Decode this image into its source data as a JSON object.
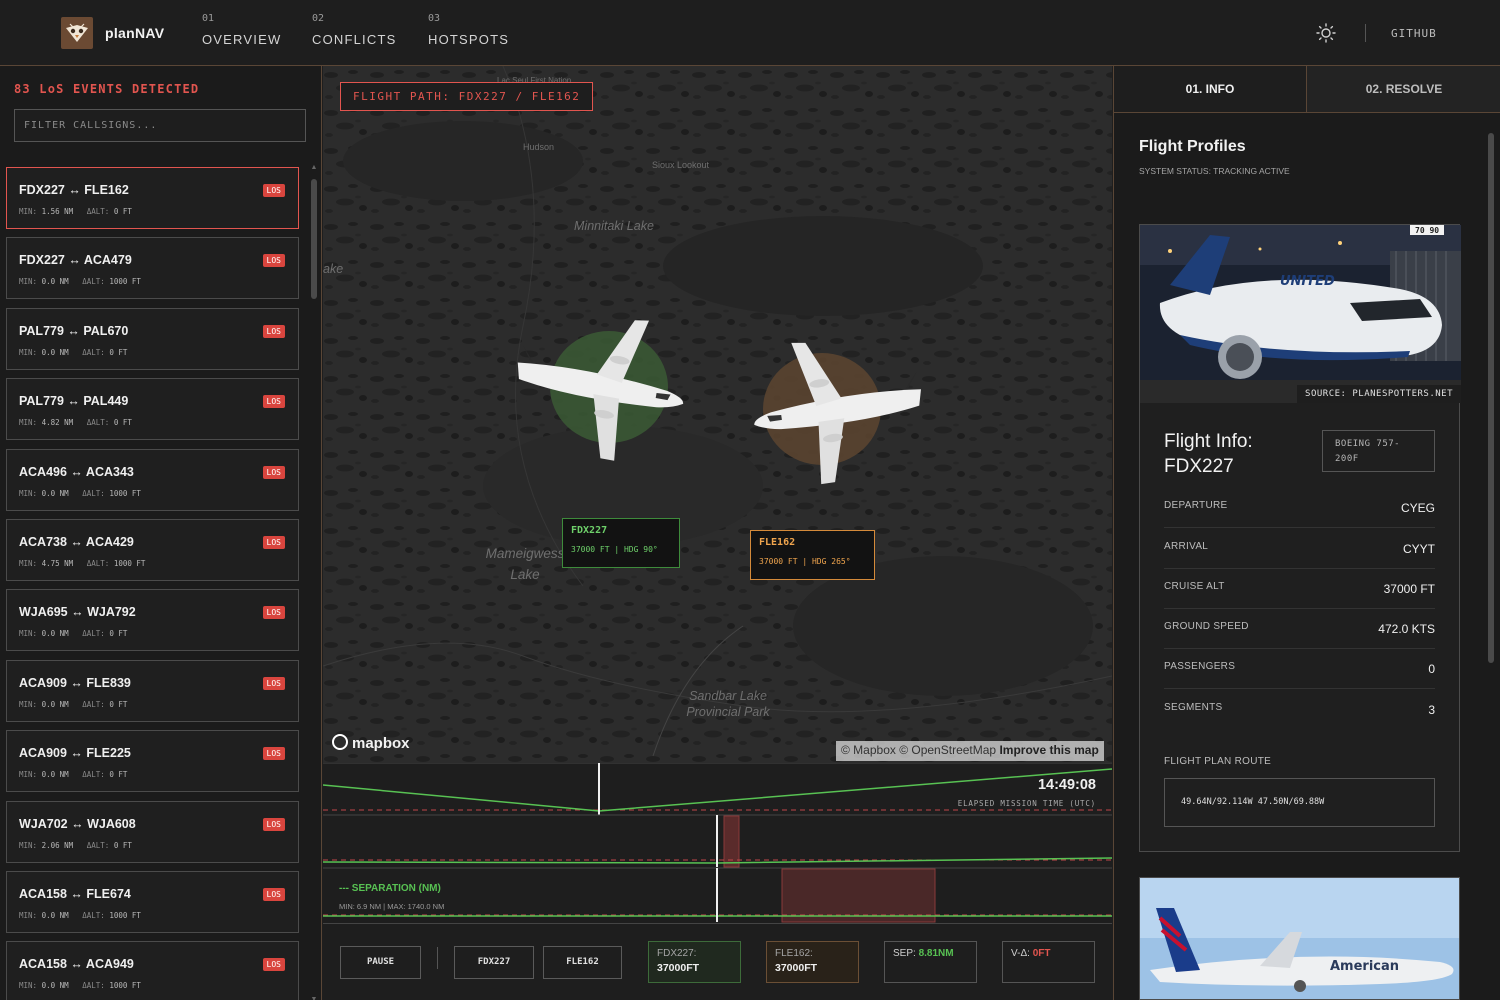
{
  "brand": {
    "name": "planNAV"
  },
  "nav": [
    {
      "num": "01",
      "label": "OVERVIEW"
    },
    {
      "num": "02",
      "label": "CONFLICTS"
    },
    {
      "num": "03",
      "label": "HOTSPOTS"
    }
  ],
  "header": {
    "github": "GITHUB"
  },
  "left": {
    "title": "83 LoS EVENTS DETECTED",
    "filter_placeholder": "FILTER CALLSIGNS...",
    "min_key": "MIN:",
    "alt_key": "ΔALT:",
    "events": [
      {
        "pair": "FDX227 ↔ FLE162",
        "badge": "LOS",
        "min": "1.56 NM",
        "dalt": "0 FT"
      },
      {
        "pair": "FDX227 ↔ ACA479",
        "badge": "LOS",
        "min": "0.0 NM",
        "dalt": "1000 FT"
      },
      {
        "pair": "PAL779 ↔ PAL670",
        "badge": "LOS",
        "min": "0.0 NM",
        "dalt": "0 FT"
      },
      {
        "pair": "PAL779 ↔ PAL449",
        "badge": "LOS",
        "min": "4.82 NM",
        "dalt": "0 FT"
      },
      {
        "pair": "ACA496 ↔ ACA343",
        "badge": "LOS",
        "min": "0.0 NM",
        "dalt": "1000 FT"
      },
      {
        "pair": "ACA738 ↔ ACA429",
        "badge": "LOS",
        "min": "4.75 NM",
        "dalt": "1000 FT"
      },
      {
        "pair": "WJA695 ↔ WJA792",
        "badge": "LOS",
        "min": "0.0 NM",
        "dalt": "0 FT"
      },
      {
        "pair": "ACA909 ↔ FLE839",
        "badge": "LOS",
        "min": "0.0 NM",
        "dalt": "0 FT"
      },
      {
        "pair": "ACA909 ↔ FLE225",
        "badge": "LOS",
        "min": "0.0 NM",
        "dalt": "0 FT"
      },
      {
        "pair": "WJA702 ↔ WJA608",
        "badge": "LOS",
        "min": "2.06 NM",
        "dalt": "0 FT"
      },
      {
        "pair": "ACA158 ↔ FLE674",
        "badge": "LOS",
        "min": "0.0 NM",
        "dalt": "1000 FT"
      },
      {
        "pair": "ACA158 ↔ ACA949",
        "badge": "LOS",
        "min": "0.0 NM",
        "dalt": "1000 FT"
      }
    ]
  },
  "map": {
    "path_label": "FLIGHT PATH: FDX227 / FLE162",
    "labels": {
      "lac_seul": "Lac Seul First Nation",
      "hudson": "Hudson",
      "sioux": "Sioux Lookout",
      "minnitaki": "Minnitaki Lake",
      "ake": "ake",
      "mameigwess": "Mameigwess Lake",
      "sandbar": "Sandbar Lake Provincial Park"
    },
    "aircraft_a": {
      "callsign": "FDX227",
      "detail": "37000 FT | HDG 90°",
      "color": "#6ed06a"
    },
    "aircraft_b": {
      "callsign": "FLE162",
      "detail": "37000 FT | HDG 265°",
      "color": "#f0a54e"
    },
    "mapbox": "mapbox",
    "attribution_a": "© Mapbox © OpenStreetMap",
    "attribution_b": "Improve this map"
  },
  "timeline": {
    "clock": "14:49:08",
    "elapsed_label": "ELAPSED MISSION TIME (UTC)",
    "sep_title": "--- SEPARATION (NM)",
    "sep_range": "MIN: 6.9 NM | MAX: 1740.0 NM"
  },
  "controls": {
    "pause": "PAUSE",
    "btn_a": "FDX227",
    "btn_b": "FLE162",
    "box_a_label": "FDX227:",
    "box_a_value": "37000FT",
    "box_b_label": "FLE162:",
    "box_b_value": "37000FT",
    "sep_label": "SEP:",
    "sep_value": "8.81NM",
    "vd_label": "V-Δ:",
    "vd_value": "0FT"
  },
  "right": {
    "tabs": [
      "01. INFO",
      "02. RESOLVE"
    ],
    "title": "Flight Profiles",
    "status": "SYSTEM STATUS: TRACKING ACTIVE",
    "photo_source": "SOURCE: PLANESPOTTERS.NET",
    "photo_reg": "70 90",
    "airline_a": "UNITED",
    "flight_info_title": "Flight Info: FDX227",
    "aircraft_type": "BOEING 757-200F",
    "rows": [
      {
        "k": "DEPARTURE",
        "v": "CYEG"
      },
      {
        "k": "ARRIVAL",
        "v": "CYYT"
      },
      {
        "k": "CRUISE ALT",
        "v": "37000 FT"
      },
      {
        "k": "GROUND SPEED",
        "v": "472.0 KTS"
      },
      {
        "k": "PASSENGERS",
        "v": "0"
      },
      {
        "k": "SEGMENTS",
        "v": "3"
      }
    ],
    "route_label": "FLIGHT PLAN ROUTE",
    "route": "49.64N/92.114W 47.50N/69.88W",
    "airline_b": "American"
  },
  "colors": {
    "accent_red": "#e2554f",
    "green": "#58c253",
    "orange": "#f0a54e",
    "border_brown": "#5a4636"
  }
}
